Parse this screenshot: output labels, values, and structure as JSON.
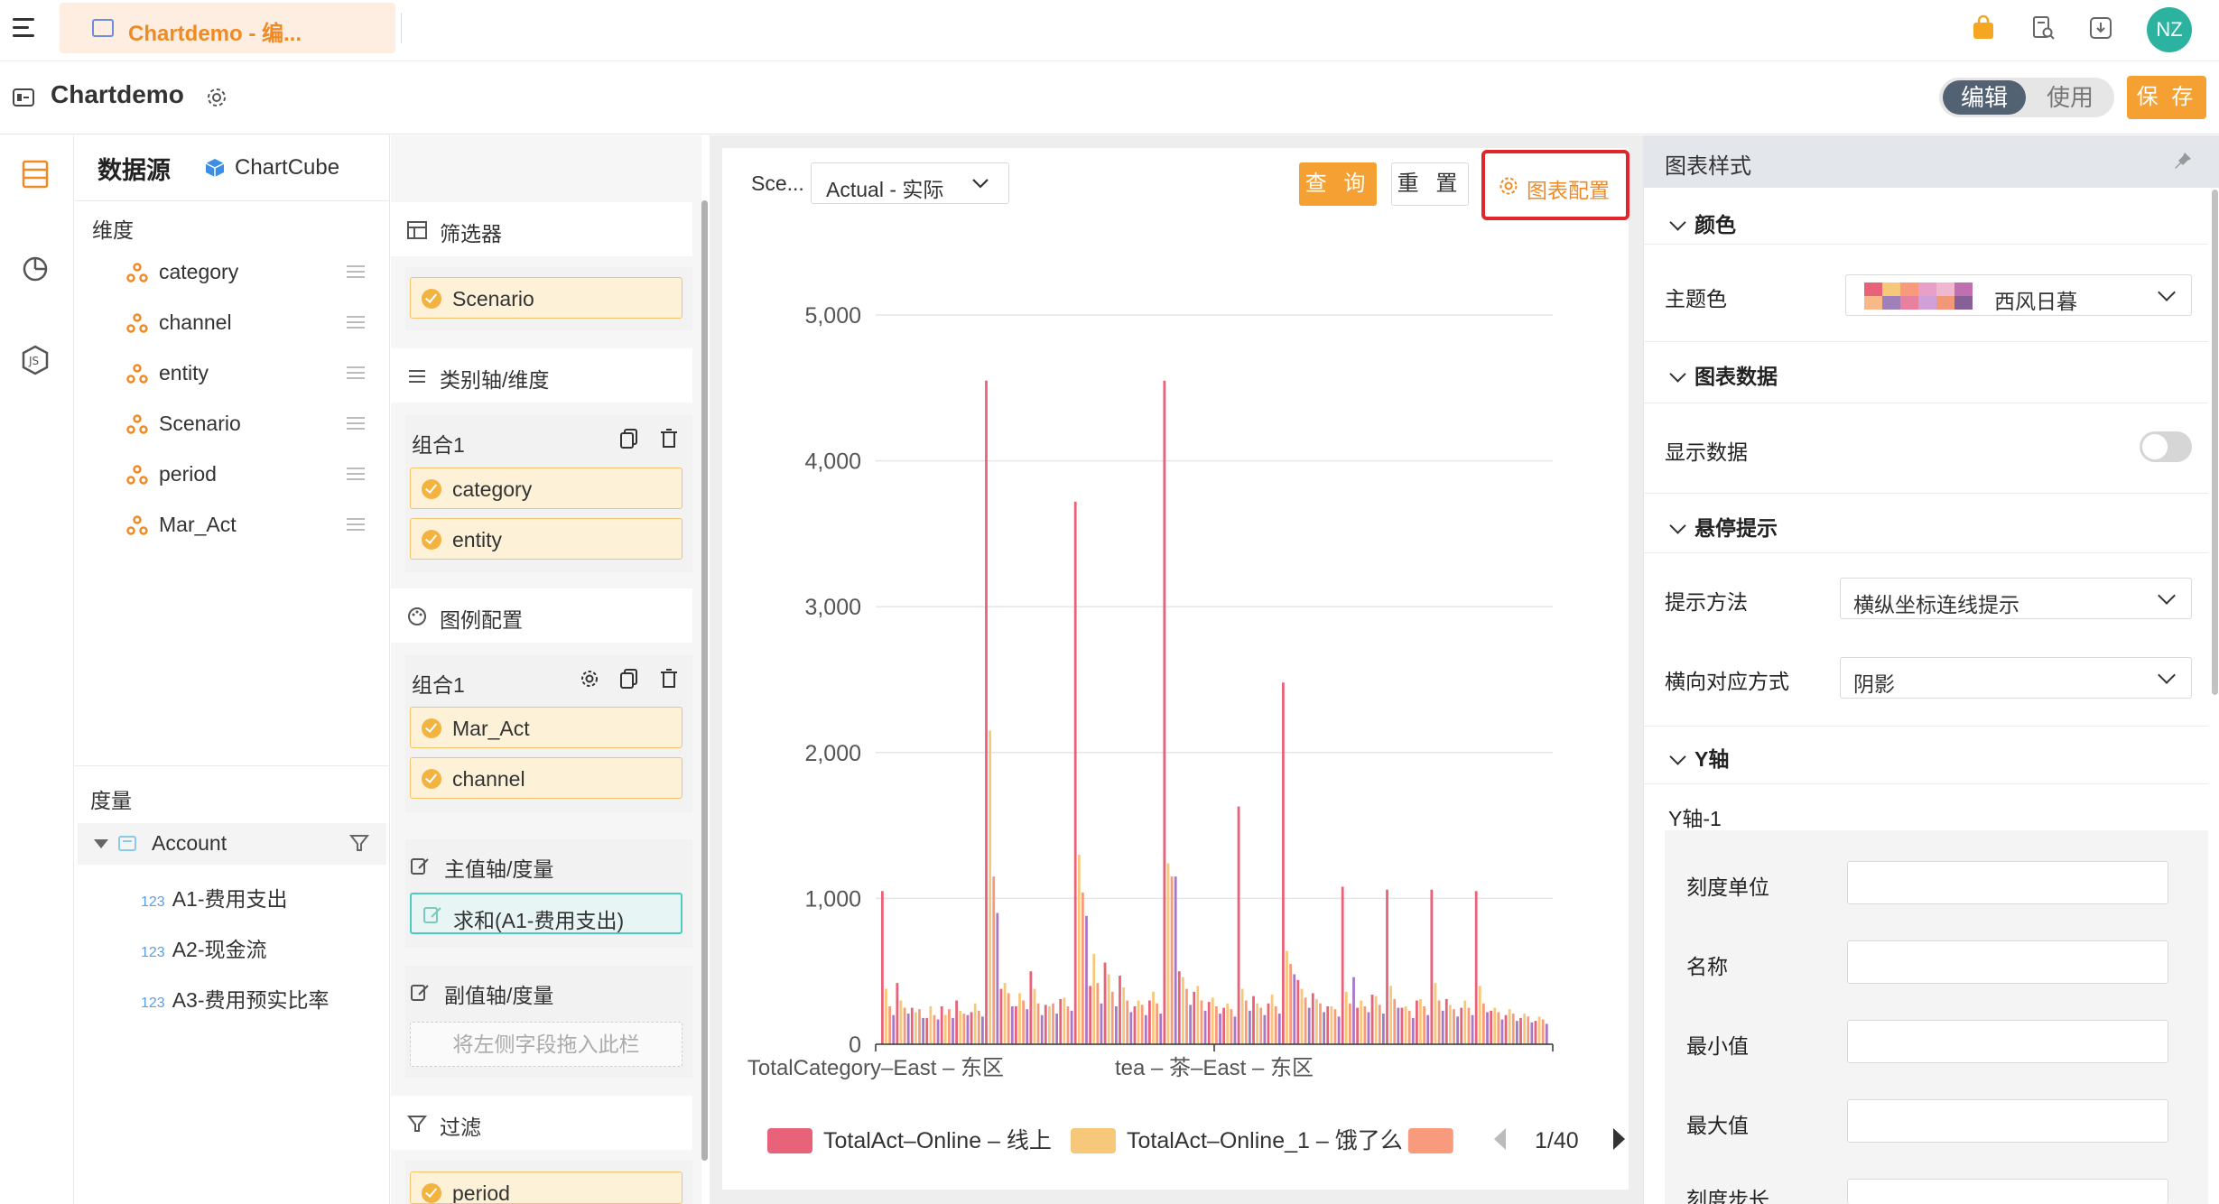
{
  "tab": {
    "label": "Chartdemo - 编..."
  },
  "header": {
    "avatar_initials": "NZ"
  },
  "titlebar": {
    "title": "Chartdemo",
    "mode_edit": "编辑",
    "mode_use": "使用",
    "save": "保 存"
  },
  "datasource": {
    "title": "数据源",
    "cube": "ChartCube",
    "dimensions_label": "维度",
    "dimensions": [
      "category",
      "channel",
      "entity",
      "Scenario",
      "period",
      "Mar_Act"
    ],
    "measures_label": "度量",
    "account_label": "Account",
    "measures": [
      "A1-费用支出",
      "A2-现金流",
      "A3-费用预实比率"
    ],
    "measure_type": "123"
  },
  "config": {
    "filter_title": "筛选器",
    "filter_fields": [
      "Scenario"
    ],
    "category_title": "类别轴/维度",
    "category_group": "组合1",
    "category_fields": [
      "category",
      "entity"
    ],
    "legend_title": "图例配置",
    "legend_group": "组合1",
    "legend_fields": [
      "Mar_Act",
      "channel"
    ],
    "primary_title": "主值轴/度量",
    "primary_fields": [
      "求和(A1-费用支出)"
    ],
    "secondary_title": "副值轴/度量",
    "drop_placeholder": "将左侧字段拖入此栏",
    "filter2_title": "过滤",
    "filter2_fields": [
      "period"
    ]
  },
  "toolbar": {
    "scenario_label": "Sce...",
    "scenario_value": "Actual - 实际",
    "query": "查 询",
    "reset": "重 置",
    "chart_config": "图表配置"
  },
  "chart_data": {
    "type": "bar",
    "ylim": [
      0,
      5000
    ],
    "yticks": [
      "0",
      "1,000",
      "2,000",
      "3,000",
      "4,000",
      "5,000"
    ],
    "x_tick_labels": [
      "TotalCategory–East – 东区",
      "tea – 茶–East – 东区"
    ],
    "grid": true,
    "legend_position": "bottom",
    "series": [
      {
        "name": "TotalAct–Online – 线上",
        "color": "#e8637a",
        "values": [
          1050,
          420,
          250,
          180,
          260,
          300,
          220,
          4550,
          380,
          260,
          500,
          270,
          310,
          3720,
          400,
          560,
          470,
          260,
          300,
          4550,
          500,
          360,
          290,
          250,
          1630,
          330,
          280,
          2480,
          440,
          350,
          260,
          1080,
          250,
          340,
          1060,
          250,
          300,
          1060,
          310,
          250,
          1050,
          230,
          200,
          180,
          160
        ]
      },
      {
        "name": "TotalAct–Online_1 – 饿了么",
        "color": "#f8c87a",
        "values": [
          380,
          300,
          220,
          260,
          200,
          230,
          280,
          2150,
          420,
          350,
          380,
          260,
          320,
          1300,
          620,
          480,
          390,
          300,
          360,
          1240,
          460,
          400,
          320,
          280,
          380,
          280,
          340,
          640,
          380,
          310,
          260,
          360,
          300,
          330,
          400,
          260,
          310,
          420,
          270,
          300,
          400,
          250,
          240,
          210,
          190
        ]
      },
      {
        "name": "",
        "color": "#f89b7c",
        "values": [
          260,
          250,
          240,
          200,
          240,
          210,
          230,
          1150,
          350,
          300,
          280,
          280,
          260,
          1040,
          420,
          360,
          300,
          270,
          280,
          1150,
          380,
          300,
          260,
          240,
          300,
          250,
          260,
          550,
          320,
          280,
          240,
          280,
          260,
          270,
          310,
          230,
          260,
          300,
          240,
          250,
          280,
          220,
          210,
          190,
          170
        ]
      },
      {
        "name": "",
        "color": "#a878c8",
        "values": [
          200,
          210,
          180,
          170,
          180,
          200,
          190,
          900,
          260,
          240,
          200,
          210,
          230,
          880,
          280,
          260,
          220,
          200,
          210,
          1150,
          270,
          230,
          210,
          190,
          230,
          200,
          210,
          480,
          250,
          220,
          190,
          460,
          220,
          210,
          250,
          180,
          200,
          230,
          190,
          200,
          220,
          170,
          160,
          150,
          140
        ]
      }
    ],
    "legend_page": "1/40"
  },
  "right_panel": {
    "title": "图表样式",
    "color_section": "颜色",
    "theme_label": "主题色",
    "theme_value": "西风日暮",
    "theme_colors": [
      "#e8637a",
      "#f8c87a",
      "#f89b7c",
      "#e8a0c8",
      "#f0b8d0",
      "#c070b0",
      "#f8b888",
      "#a080b8",
      "#e880a0",
      "#d0a0d8",
      "#f09878",
      "#886098"
    ],
    "data_section": "图表数据",
    "show_data_label": "显示数据",
    "show_data": false,
    "tooltip_section": "悬停提示",
    "tooltip_method_label": "提示方法",
    "tooltip_method_value": "横纵坐标连线提示",
    "horizontal_label": "横向对应方式",
    "horizontal_value": "阴影",
    "yaxis_section": "Y轴",
    "yaxis_sub": "Y轴-1",
    "yaxis_fields": [
      "刻度单位",
      "名称",
      "最小值",
      "最大值",
      "刻度步长"
    ]
  }
}
